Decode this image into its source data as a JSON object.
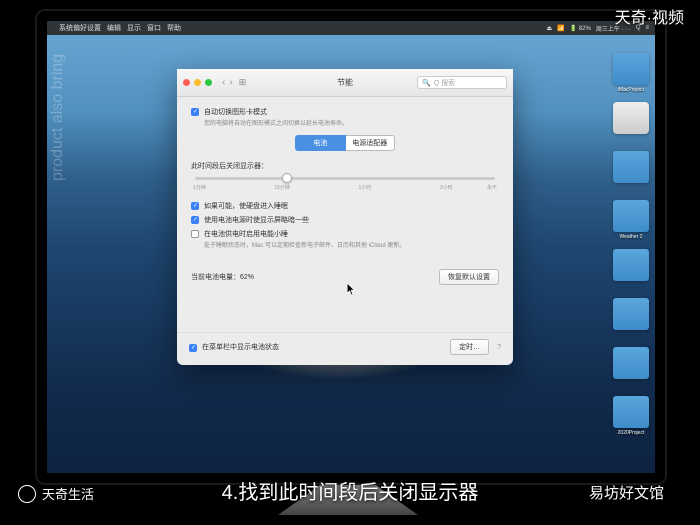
{
  "watermarks": {
    "top_right": "天奇·视频",
    "bottom_left": "天奇生活",
    "bottom_right": "易坊好文馆"
  },
  "caption": "4.找到此时间段后关闭显示器",
  "menubar": {
    "apple": "",
    "app": "系统偏好设置",
    "items": [
      "编辑",
      "显示",
      "窗口",
      "帮助"
    ],
    "right": [
      "⏏",
      "📶",
      "🔋 82%",
      "周三上午 · · ·",
      "Q",
      "≡"
    ]
  },
  "desktop_icons": [
    {
      "label": "iMacProject"
    },
    {
      "label": ""
    },
    {
      "label": ""
    },
    {
      "label": "Weather 2"
    },
    {
      "label": ""
    },
    {
      "label": ""
    },
    {
      "label": ""
    },
    {
      "label": "2020Project"
    }
  ],
  "left_text": "product also bring",
  "prefs": {
    "title": "节能",
    "search_placeholder": "Q 搜索",
    "opt_auto": {
      "checked": true,
      "label": "自动切换图形卡模式"
    },
    "opt_auto_hint": "您的电脑将自动在图形模式之间切换以延长电池寿命。",
    "tabs": {
      "a": "电池",
      "b": "电源适配器",
      "active": "a"
    },
    "slider_label": "此时间段后关闭显示器：",
    "slider_ticks": [
      "1分钟",
      "",
      "15分钟",
      "",
      "1小时",
      "",
      "3小时",
      "永不"
    ],
    "opt_dim": {
      "checked": true,
      "label": "如果可能，使硬盘进入睡眠"
    },
    "opt_bat_dim": {
      "checked": true,
      "label": "使用电池电源时使显示屏略暗一些"
    },
    "opt_nap": {
      "checked": false,
      "label": "在电池供电时启用电能小睡"
    },
    "opt_nap_hint": "处于睡眠状态时，Mac 可以定期检查新电子邮件、日历和其他 iCloud 更新。",
    "battery_status": "当前电池电量：62%",
    "restore_btn": "恢复默认设置",
    "footer_check": {
      "checked": true,
      "label": "在菜单栏中显示电池状态"
    },
    "schedule_btn": "定时…"
  }
}
